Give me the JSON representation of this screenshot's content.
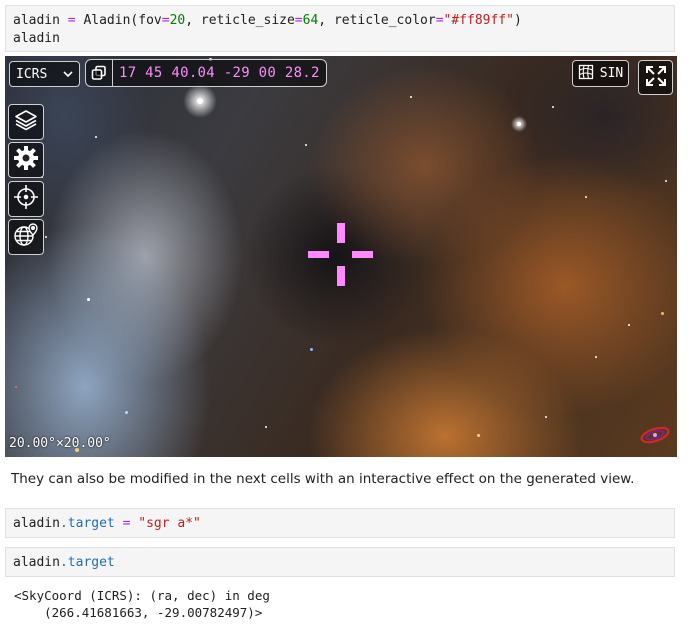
{
  "cell1": {
    "line1": {
      "var": "aladin",
      "op": "=",
      "call": "Aladin(",
      "k1": "fov",
      "v1": "20",
      "k2": "reticle_size",
      "v2": "64",
      "k3": "reticle_color",
      "v3": "\"#ff89ff\"",
      "close": ")"
    },
    "line2": "aladin"
  },
  "viewer": {
    "frame": "ICRS",
    "coordinates": "17 45 40.04 -29 00 28.2",
    "projection": "SIN",
    "fov": "20.00°×20.00°",
    "reticle_color": "#ff89ff",
    "icons": [
      "layers-icon",
      "gear-icon",
      "crosshair-icon",
      "globe-pin-icon",
      "copy-icon",
      "grid-icon",
      "fullscreen-icon",
      "chevron-down-icon",
      "aladin-logo"
    ]
  },
  "markdown": "They can also be modified in the next cells with an interactive effect on the generated view.",
  "cell2": {
    "obj": "aladin",
    "attr": ".target",
    "op": "=",
    "val": "\"sgr a*\""
  },
  "cell3": {
    "obj": "aladin",
    "attr": ".target"
  },
  "output": {
    "line1": "<SkyCoord (ICRS): (ra, dec) in deg",
    "line2": "    (266.41681663, -29.00782497)>"
  }
}
